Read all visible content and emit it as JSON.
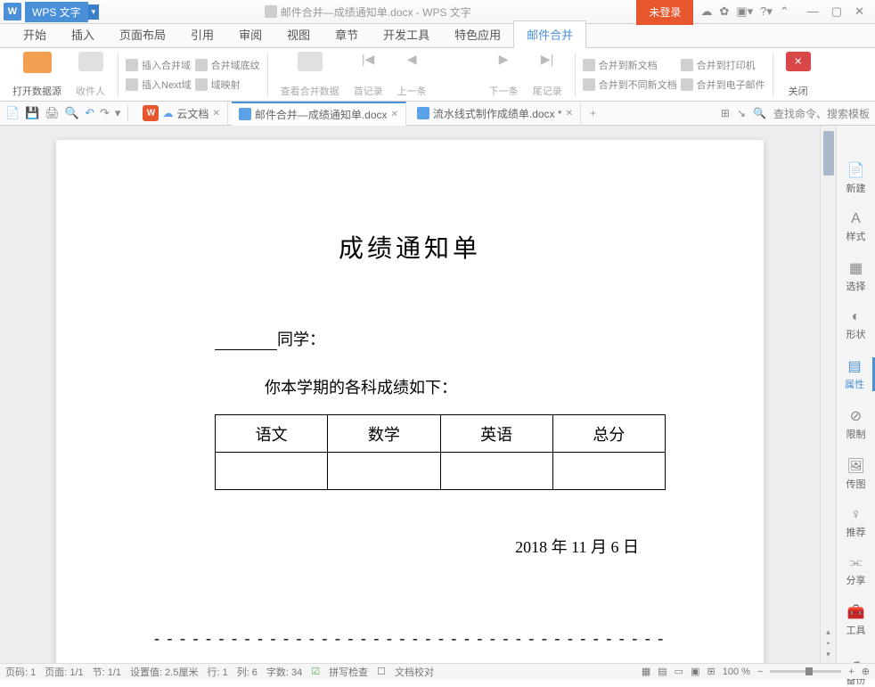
{
  "titlebar": {
    "app_name": "WPS 文字",
    "doc_title": "邮件合并—成绩通知单.docx - WPS 文字",
    "login_button": "未登录"
  },
  "menu": {
    "tabs": [
      "开始",
      "插入",
      "页面布局",
      "引用",
      "审阅",
      "视图",
      "章节",
      "开发工具",
      "特色应用",
      "邮件合并"
    ]
  },
  "ribbon": {
    "open_data_source": "打开数据源",
    "recipients": "收件人",
    "insert_merge_field": "插入合并域",
    "insert_next": "插入Next域",
    "merge_field_shading": "合并域底纹",
    "field_mapping": "域映射",
    "view_merge_data": "查看合并数据",
    "first_record": "首记录",
    "prev_record": "上一条",
    "next_record": "下一条",
    "last_record": "尾记录",
    "merge_to_new_doc": "合并到新文档",
    "merge_to_diff_doc": "合并到不同新文档",
    "merge_to_printer": "合并到打印机",
    "merge_to_email": "合并到电子邮件",
    "close": "关闭"
  },
  "doc_tabs": {
    "cloud": "云文档",
    "tab1": "邮件合并—成绩通知单.docx",
    "tab2": "流水线式制作成绩单.docx *",
    "search_placeholder": "查找命令、搜索模板"
  },
  "document": {
    "title": "成绩通知单",
    "student_suffix": "同学：",
    "intro": "你本学期的各科成绩如下：",
    "headers": [
      "语文",
      "数学",
      "英语",
      "总分"
    ],
    "date": "2018 年 11 月 6 日"
  },
  "sidebar": {
    "items": [
      "新建",
      "样式",
      "选择",
      "形状",
      "属性",
      "限制",
      "传图",
      "推荐",
      "分享",
      "工具",
      "备份"
    ]
  },
  "statusbar": {
    "page_num": "页码: 1",
    "page_count": "页面: 1/1",
    "section": "节: 1/1",
    "position": "设置值: 2.5厘米",
    "line": "行: 1",
    "column": "列: 6",
    "char_count": "字数: 34",
    "spell": "拼写检查",
    "doc_check": "文档校对",
    "zoom": "100 %"
  }
}
